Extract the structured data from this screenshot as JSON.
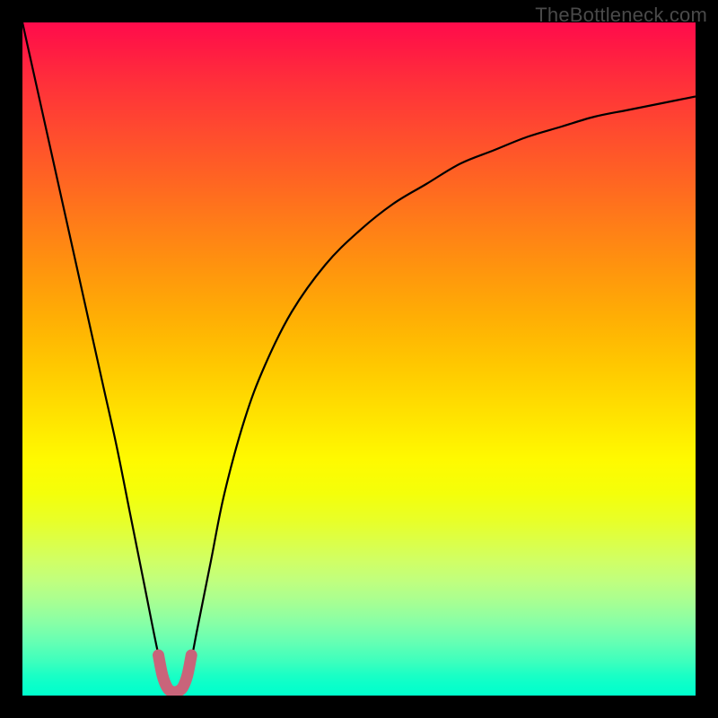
{
  "watermark": "TheBottleneck.com",
  "chart_data": {
    "type": "line",
    "title": "",
    "xlabel": "",
    "ylabel": "",
    "xlim": [
      0,
      100
    ],
    "ylim": [
      0,
      100
    ],
    "grid": false,
    "gradient_stops": [
      {
        "pos": 0,
        "color": "#ff0b4c"
      },
      {
        "pos": 25,
        "color": "#ff6a20"
      },
      {
        "pos": 50,
        "color": "#ffc800"
      },
      {
        "pos": 70,
        "color": "#f4ff0a"
      },
      {
        "pos": 85,
        "color": "#a8ff92"
      },
      {
        "pos": 100,
        "color": "#00ffcc"
      }
    ],
    "series": [
      {
        "name": "bottleneck-curve",
        "color": "#000000",
        "width": 2.2,
        "x": [
          0,
          2,
          4,
          6,
          8,
          10,
          12,
          14,
          16,
          18,
          20,
          21,
          22,
          23,
          24,
          25,
          26,
          28,
          30,
          33,
          36,
          40,
          45,
          50,
          55,
          60,
          65,
          70,
          75,
          80,
          85,
          90,
          95,
          100
        ],
        "y": [
          100,
          91,
          82,
          73,
          64,
          55,
          46,
          37,
          27,
          17,
          7,
          3,
          1,
          1,
          2,
          5,
          10,
          20,
          30,
          41,
          49,
          57,
          64,
          69,
          73,
          76,
          79,
          81,
          83,
          84.5,
          86,
          87,
          88,
          89
        ]
      },
      {
        "name": "optimal-marker",
        "color": "#c9647a",
        "width": 13,
        "linecap": "round",
        "x": [
          20.2,
          20.8,
          21.5,
          22.2,
          23.0,
          23.8,
          24.5,
          25.1
        ],
        "y": [
          6.0,
          3.0,
          1.2,
          0.6,
          0.6,
          1.2,
          3.0,
          6.0
        ]
      }
    ]
  }
}
